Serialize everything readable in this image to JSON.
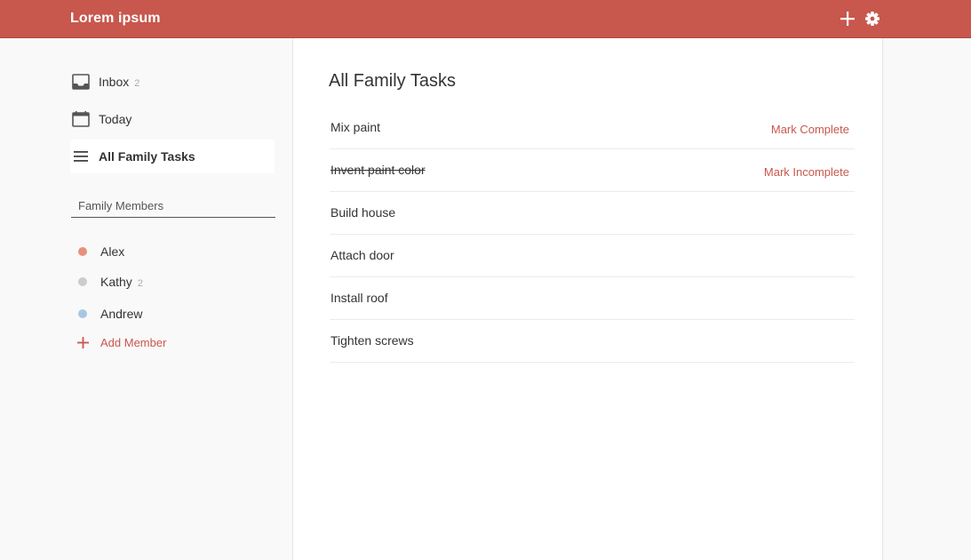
{
  "header": {
    "title": "Lorem ipsum",
    "add_icon": "plus-icon",
    "settings_icon": "gear-icon",
    "color": "#c8574d"
  },
  "sidebar": {
    "nav": [
      {
        "label": "Inbox",
        "count": "2",
        "icon": "inbox-icon"
      },
      {
        "label": "Today",
        "count": "",
        "icon": "calendar-icon"
      },
      {
        "label": "All Family Tasks",
        "count": "",
        "icon": "list-icon",
        "active": true
      }
    ],
    "section_label": "Family Members",
    "members": [
      {
        "name": "Alex",
        "count": "",
        "color": "#e8907e"
      },
      {
        "name": "Kathy",
        "count": "2",
        "color": "#cccccc"
      },
      {
        "name": "Andrew",
        "count": "",
        "color": "#a9c7e3"
      }
    ],
    "add_member_label": "Add Member"
  },
  "main": {
    "title": "All Family Tasks",
    "tasks": [
      {
        "text": "Mix paint",
        "done": false,
        "action": "Mark Complete"
      },
      {
        "text": "Invent paint color",
        "done": true,
        "action": "Mark Incomplete"
      },
      {
        "text": "Build house",
        "done": false,
        "action": ""
      },
      {
        "text": "Attach door",
        "done": false,
        "action": ""
      },
      {
        "text": "Install roof",
        "done": false,
        "action": ""
      },
      {
        "text": "Tighten screws",
        "done": false,
        "action": ""
      }
    ]
  }
}
